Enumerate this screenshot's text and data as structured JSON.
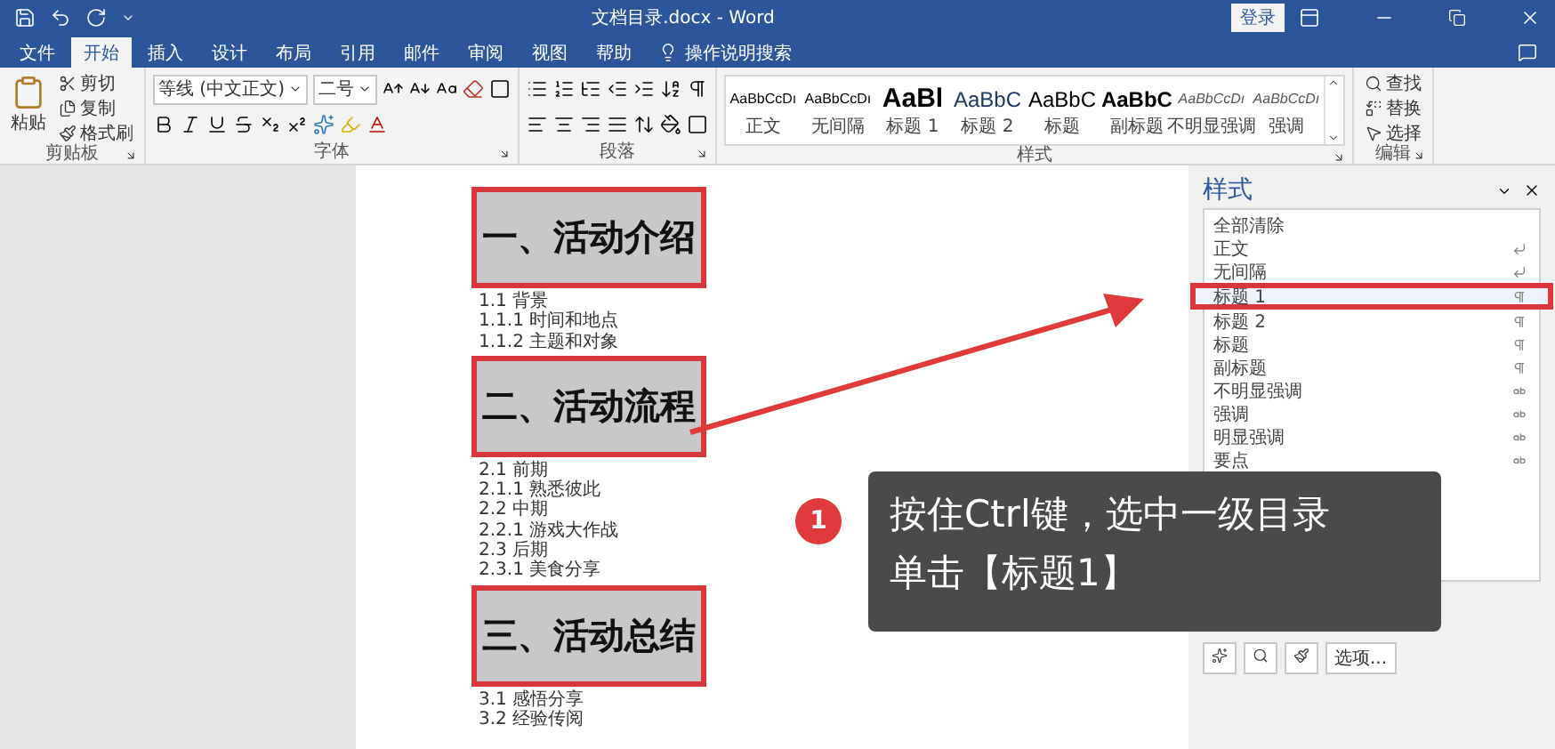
{
  "window": {
    "title": "文档目录.docx - Word",
    "sign_in": "登录"
  },
  "tabs": [
    {
      "label": "文件",
      "selected": false
    },
    {
      "label": "开始",
      "selected": true
    },
    {
      "label": "插入",
      "selected": false
    },
    {
      "label": "设计",
      "selected": false
    },
    {
      "label": "布局",
      "selected": false
    },
    {
      "label": "引用",
      "selected": false
    },
    {
      "label": "邮件",
      "selected": false
    },
    {
      "label": "审阅",
      "selected": false
    },
    {
      "label": "视图",
      "selected": false
    },
    {
      "label": "帮助",
      "selected": false
    }
  ],
  "tell_me": "操作说明搜索",
  "ribbon": {
    "clipboard": {
      "paste": "粘贴",
      "cut": "剪切",
      "copy": "复制",
      "format_painter": "格式刷",
      "label": "剪贴板"
    },
    "font": {
      "name": "等线 (中文正文)",
      "size": "二号",
      "label": "字体"
    },
    "paragraph": {
      "label": "段落"
    },
    "styles": {
      "label": "样式",
      "gallery": [
        {
          "preview": "AaBbCcDı",
          "name": "正文",
          "kind": "normal"
        },
        {
          "preview": "AaBbCcDı",
          "name": "无间隔",
          "kind": "normal"
        },
        {
          "preview": "AaBl",
          "name": "标题 1",
          "kind": "heading1"
        },
        {
          "preview": "AaBbC",
          "name": "标题 2",
          "kind": "heading2"
        },
        {
          "preview": "AaBbC",
          "name": "标题",
          "kind": "title"
        },
        {
          "preview": "AaBbC",
          "name": "副标题",
          "kind": "subtitle"
        },
        {
          "preview": "AaBbCcDı",
          "name": "不明显强调",
          "kind": "emphasis"
        },
        {
          "preview": "AaBbCcDı",
          "name": "强调",
          "kind": "emphasis"
        }
      ]
    },
    "editing": {
      "find": "查找",
      "replace": "替换",
      "select": "选择",
      "label": "编辑"
    }
  },
  "document": {
    "sections": [
      {
        "heading": "一、活动介绍",
        "selected": true,
        "callout": true,
        "items": [
          "1.1 背景",
          "1.1.1 时间和地点",
          "1.1.2 主题和对象"
        ]
      },
      {
        "heading": "二、活动流程",
        "selected": true,
        "callout": true,
        "items": [
          "2.1 前期",
          "2.1.1 熟悉彼此",
          "2.2 中期",
          "2.2.1 游戏大作战",
          "2.3 后期",
          "2.3.1 美食分享"
        ]
      },
      {
        "heading": "三、活动总结",
        "selected": true,
        "callout": true,
        "items": [
          "3.1 感悟分享",
          "3.2 经验传阅"
        ]
      }
    ]
  },
  "styles_pane": {
    "title": "样式",
    "items": [
      {
        "name": "全部清除",
        "kind": "none",
        "selected": false,
        "callout": false
      },
      {
        "name": "正文",
        "kind": "paragraph",
        "selected": false,
        "callout": false
      },
      {
        "name": "无间隔",
        "kind": "paragraph",
        "selected": false,
        "callout": false
      },
      {
        "name": "标题 1",
        "kind": "linked",
        "selected": true,
        "callout": true
      },
      {
        "name": "标题 2",
        "kind": "linked",
        "selected": false,
        "callout": false
      },
      {
        "name": "标题",
        "kind": "linked",
        "selected": false,
        "callout": false
      },
      {
        "name": "副标题",
        "kind": "linked",
        "selected": false,
        "callout": false
      },
      {
        "name": "不明显强调",
        "kind": "character",
        "selected": false,
        "callout": false
      },
      {
        "name": "强调",
        "kind": "character",
        "selected": false,
        "callout": false
      },
      {
        "name": "明显强调",
        "kind": "character",
        "selected": false,
        "callout": false
      },
      {
        "name": "要点",
        "kind": "character",
        "selected": false,
        "callout": false
      }
    ],
    "options_button": "选项..."
  },
  "callout": {
    "number": "1",
    "lines": [
      "按住Ctrl键，选中一级目录",
      "单击【标题1】"
    ]
  }
}
